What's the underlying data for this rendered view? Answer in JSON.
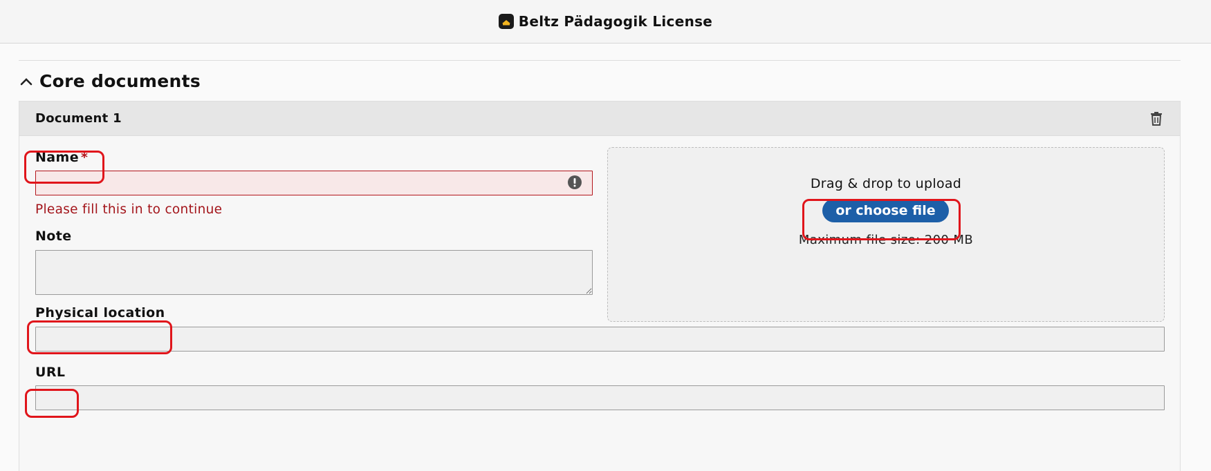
{
  "topbar": {
    "title": "Beltz Pädagogik License",
    "icon": "book-app-icon"
  },
  "section": {
    "title": "Core documents",
    "expanded": true
  },
  "document": {
    "title": "Document 1",
    "name": {
      "label": "Name",
      "required_mark": "*",
      "value": "",
      "error": "Please fill this in to continue"
    },
    "note": {
      "label": "Note",
      "value": ""
    },
    "physical_location": {
      "label": "Physical location",
      "value": ""
    },
    "url": {
      "label": "URL",
      "value": ""
    },
    "upload": {
      "prompt": "Drag & drop to upload",
      "button_label": "or choose file",
      "max_size": "Maximum file size: 200 MB"
    }
  },
  "colors": {
    "accent": "#1d5fa8",
    "error": "#a3151b",
    "annotation": "#e0151b"
  }
}
